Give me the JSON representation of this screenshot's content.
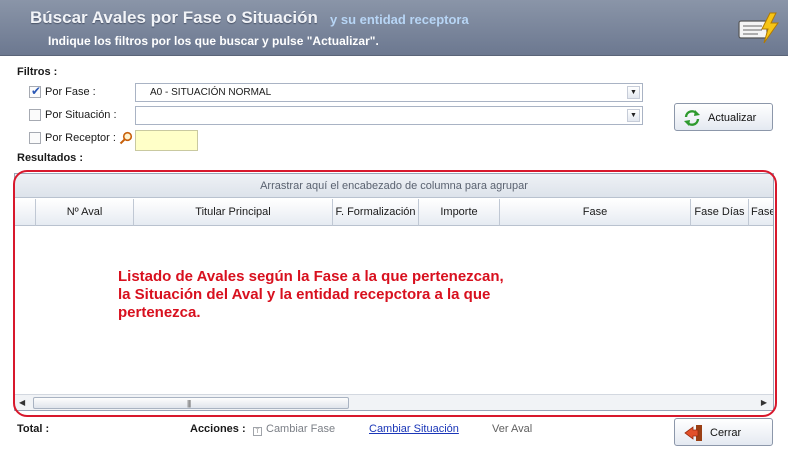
{
  "header": {
    "title": "Búscar Avales por Fase o Situación",
    "subtitle": "y su entidad receptora",
    "hint": "Indique los filtros por los que buscar y pulse \"Actualizar\".",
    "icon": "report-lightning-icon"
  },
  "filters": {
    "label": "Filtros :",
    "por_fase": {
      "label": "Por Fase :",
      "checked": true,
      "value": "A0 - SITUACIÓN NORMAL"
    },
    "por_situacion": {
      "label": "Por Situación :",
      "checked": false,
      "value": ""
    },
    "por_receptor": {
      "label": "Por Receptor :",
      "checked": false,
      "value": ""
    }
  },
  "buttons": {
    "actualizar": "Actualizar",
    "cerrar": "Cerrar"
  },
  "results": {
    "label": "Resultados :",
    "group_panel": "Arrastrar aquí el encabezado de columna para agrupar",
    "columns": [
      "Nº Aval",
      "Titular Principal",
      "F. Formalización",
      "Importe",
      "Fase",
      "Fase Días",
      "Fase"
    ]
  },
  "annotation": "Listado de Avales según la Fase a la que pertenezcan, la Situación del Aval y la entidad recepctora a la que pertenezca.",
  "footer": {
    "total_label": "Total :",
    "acciones_label": "Acciones :",
    "cambiar_fase": "Cambiar Fase",
    "cambiar_situacion": "Cambiar Situación",
    "ver_aval": "Ver Aval"
  },
  "colors": {
    "annotation": "#d8101e",
    "header": "#7b869b",
    "link": "#1a36b8"
  }
}
